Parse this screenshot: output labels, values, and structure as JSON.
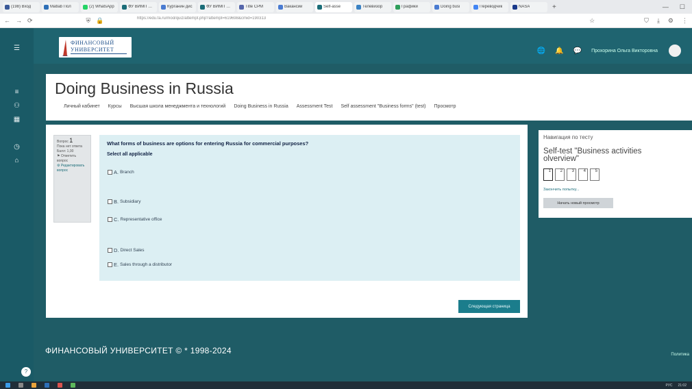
{
  "browser": {
    "tabs": [
      {
        "label": "(198) Вход",
        "color": "#3b5998"
      },
      {
        "label": "Matlab Пол",
        "color": "#2e6fb7"
      },
      {
        "label": "(2) WhatsApp",
        "color": "#25d366"
      },
      {
        "label": "ФУ ВИМП — Т",
        "color": "#1b6d78"
      },
      {
        "label": "Курганин дис",
        "color": "#4a7bd1"
      },
      {
        "label": "ФУ ВИМП — Т",
        "color": "#1b6d78"
      },
      {
        "label": "Title СРМ",
        "color": "#5566aa"
      },
      {
        "label": "Вакансии",
        "color": "#4a7bd1"
      },
      {
        "label": "Self-asse",
        "color": "#1b6d78"
      },
      {
        "label": "Телевизор",
        "color": "#3b82c4"
      },
      {
        "label": "Графики",
        "color": "#2e9e5b"
      },
      {
        "label": "Doing busi",
        "color": "#4a7bd1"
      },
      {
        "label": "Переводчик",
        "color": "#4285f4"
      },
      {
        "label": "NASA",
        "color": "#1a3a8a"
      }
    ],
    "new_tab": "+",
    "url": "https://edu.fa.ru/mod/quiz/attempt.php?attempt=619698&cmid=190313"
  },
  "header": {
    "logo_line1": "ФИНАНСОВЫЙ",
    "logo_line2": "УНИВЕРСИТЕТ",
    "user_name": "Прохорина Ольга Викторовна"
  },
  "page": {
    "title": "Doing Business in Russia",
    "breadcrumb": [
      "Личный кабинет",
      "Курсы",
      "Высшая школа менеджмента и технологий",
      "Doing Business in Russia",
      "Assessment Test",
      "Self assessment \"Business forms\" (test)",
      "Просмотр"
    ]
  },
  "question": {
    "info_label": "Вопрос",
    "number": "1",
    "status": "Пока нет ответа",
    "points": "Балл: 1,00",
    "flag_label": "Отметить вопрос",
    "edit_label": "Редактировать вопрос",
    "text": "What forms of business are options for entering Russia for commercial purposes?",
    "prompt": "Select all applicable",
    "options": [
      {
        "letter": "A.",
        "label": "Branch"
      },
      {
        "letter": "B.",
        "label": "Subsidiary"
      },
      {
        "letter": "C.",
        "label": "Representative office"
      },
      {
        "letter": "D.",
        "label": "Direct Sales"
      },
      {
        "letter": "E.",
        "label": "Sales through a distributor"
      }
    ],
    "next_button": "Следующая страница"
  },
  "navigation": {
    "title": "Навигация по тесту",
    "quiz_name": "Self-test \"Business activities olverview\"",
    "buttons": [
      "1",
      "2",
      "3",
      "4",
      "5"
    ],
    "finish_link": "Закончить попытку...",
    "restart_button": "Начать новый просмотр"
  },
  "footer": {
    "copyright": "ФИНАНСОВЫЙ УНИВЕРСИТЕТ © * 1998-2024",
    "right_link": "Политика",
    "help": "?"
  },
  "taskbar": {
    "time": "21:02",
    "lang": "РУС"
  }
}
